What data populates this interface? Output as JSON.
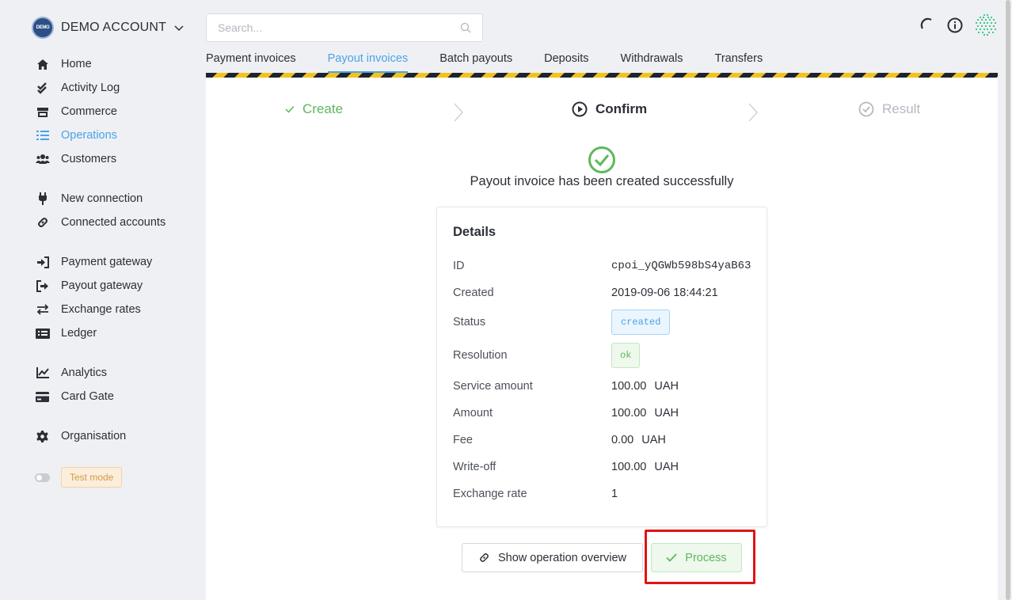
{
  "account": {
    "logo_text": "DEMO",
    "name": "DEMO ACCOUNT"
  },
  "nav": [
    {
      "label": "Home",
      "icon": "home-icon"
    },
    {
      "label": "Activity Log",
      "icon": "double-check-icon"
    },
    {
      "label": "Commerce",
      "icon": "store-icon"
    },
    {
      "label": "Operations",
      "icon": "list-icon",
      "active": true
    },
    {
      "label": "Customers",
      "icon": "users-icon"
    },
    {
      "label": "New connection",
      "icon": "plug-icon"
    },
    {
      "label": "Connected accounts",
      "icon": "link-icon"
    },
    {
      "label": "Payment gateway",
      "icon": "sign-in-icon"
    },
    {
      "label": "Payout gateway",
      "icon": "sign-out-icon"
    },
    {
      "label": "Exchange rates",
      "icon": "exchange-icon"
    },
    {
      "label": "Ledger",
      "icon": "ledger-icon"
    },
    {
      "label": "Analytics",
      "icon": "chart-icon"
    },
    {
      "label": "Card Gate",
      "icon": "card-icon"
    },
    {
      "label": "Organisation",
      "icon": "gear-icon"
    }
  ],
  "test_mode": {
    "label": "Test mode"
  },
  "search": {
    "placeholder": "Search..."
  },
  "tabs": [
    {
      "label": "Payment invoices"
    },
    {
      "label": "Payout invoices",
      "active": true
    },
    {
      "label": "Batch payouts"
    },
    {
      "label": "Deposits"
    },
    {
      "label": "Withdrawals"
    },
    {
      "label": "Transfers"
    }
  ],
  "steps": {
    "create": "Create",
    "confirm": "Confirm",
    "result": "Result"
  },
  "success_message": "Payout invoice has been created successfully",
  "details": {
    "title": "Details",
    "id_label": "ID",
    "id_value": "cpoi_yQGWb598bS4yaB63",
    "created_label": "Created",
    "created_value": "2019-09-06 18:44:21",
    "status_label": "Status",
    "status_value": "created",
    "resolution_label": "Resolution",
    "resolution_value": "ok",
    "service_amount_label": "Service amount",
    "service_amount_value": "100.00",
    "service_amount_currency": "UAH",
    "amount_label": "Amount",
    "amount_value": "100.00",
    "amount_currency": "UAH",
    "fee_label": "Fee",
    "fee_value": "0.00",
    "fee_currency": "UAH",
    "writeoff_label": "Write-off",
    "writeoff_value": "100.00",
    "writeoff_currency": "UAH",
    "exchange_rate_label": "Exchange rate",
    "exchange_rate_value": "1"
  },
  "buttons": {
    "overview": "Show operation overview",
    "process": "Process"
  },
  "colors": {
    "accent": "#4aa3e8",
    "success": "#5db85c",
    "highlight": "#e01414"
  }
}
